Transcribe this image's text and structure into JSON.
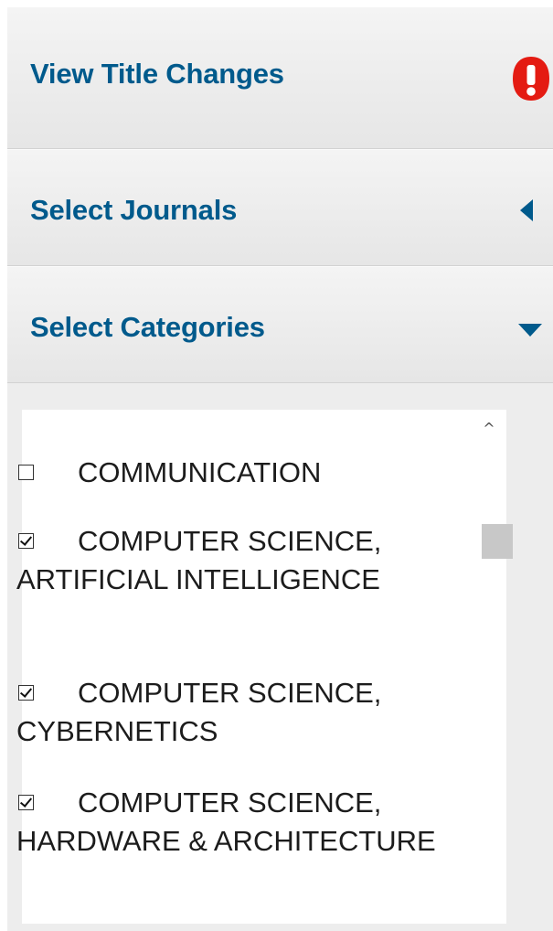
{
  "sections": {
    "view_title_changes": {
      "label": "View Title Changes",
      "icon": "alert-icon",
      "alert_color": "#e41b12"
    },
    "select_journals": {
      "label": "Select Journals",
      "icon": "caret-left-icon"
    },
    "select_categories": {
      "label": "Select Categories",
      "icon": "caret-down-icon"
    }
  },
  "accent_color": "#005a8c",
  "categories": [
    {
      "label": "COMMUNICATION",
      "checked": false
    },
    {
      "label": "COMPUTER SCIENCE, ARTIFICIAL INTELLIGENCE",
      "checked": true
    },
    {
      "label": "COMPUTER SCIENCE, CYBERNETICS",
      "checked": true
    },
    {
      "label": "COMPUTER SCIENCE, HARDWARE & ARCHITECTURE",
      "checked": true
    }
  ]
}
